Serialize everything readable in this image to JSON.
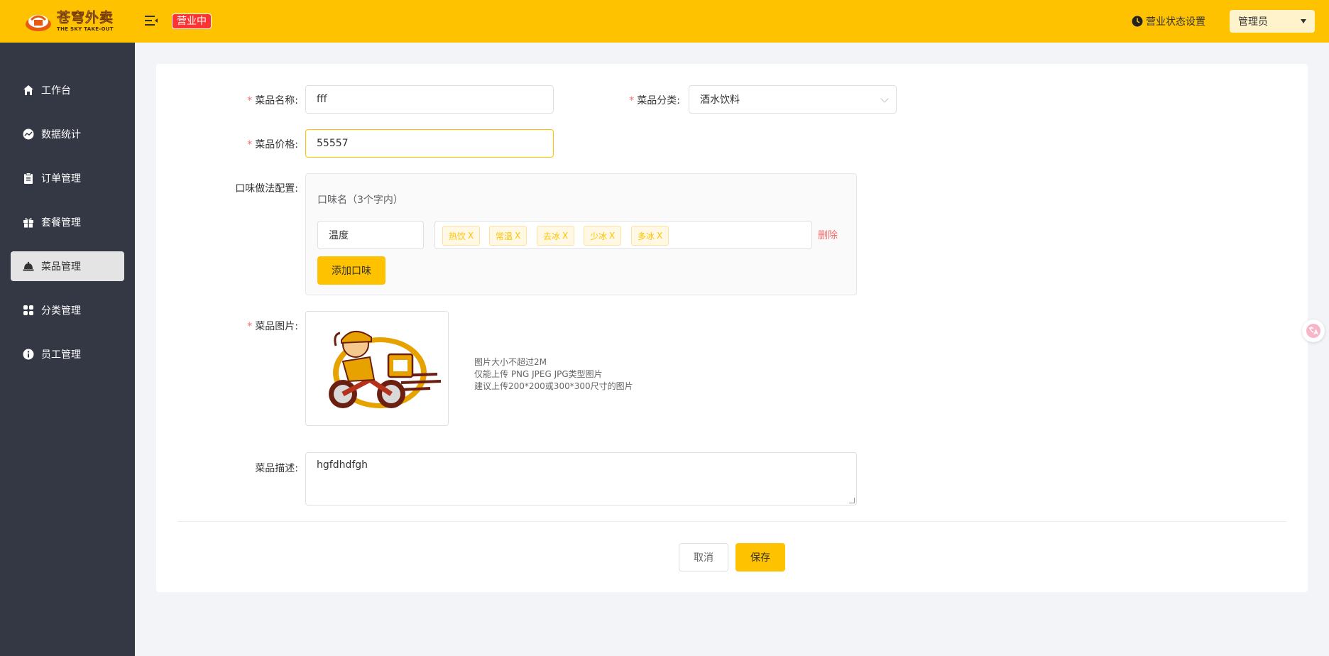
{
  "header": {
    "logo_cn": "苍穹外卖",
    "logo_en": "THE SKY TAKE-OUT",
    "status_badge": "营业中",
    "biz_settings": "营业状态设置",
    "user": "管理员"
  },
  "sidebar": {
    "items": [
      {
        "label": "工作台",
        "icon": "home-icon"
      },
      {
        "label": "数据统计",
        "icon": "chart-icon"
      },
      {
        "label": "订单管理",
        "icon": "clipboard-icon"
      },
      {
        "label": "套餐管理",
        "icon": "gift-icon"
      },
      {
        "label": "菜品管理",
        "icon": "dish-icon",
        "active": true
      },
      {
        "label": "分类管理",
        "icon": "grid-icon"
      },
      {
        "label": "员工管理",
        "icon": "info-icon"
      }
    ]
  },
  "form": {
    "name_label": "菜品名称:",
    "name_value": "fff",
    "category_label": "菜品分类:",
    "category_value": "酒水饮料",
    "price_label": "菜品价格:",
    "price_value": "55557",
    "flavor_label": "口味做法配置:",
    "flavor_hint": "口味名（3个字内）",
    "flavor_name": "温度",
    "flavor_tags": [
      "热饮",
      "常温",
      "去冰",
      "少冰",
      "多冰"
    ],
    "tag_close": "X",
    "flavor_delete": "删除",
    "add_flavor": "添加口味",
    "image_label": "菜品图片:",
    "image_tips": [
      "图片大小不超过2M",
      "仅能上传 PNG JPEG JPG类型图片",
      "建议上传200*200或300*300尺寸的图片"
    ],
    "desc_label": "菜品描述:",
    "desc_value": "hgfdhdfgh",
    "cancel": "取消",
    "save": "保存"
  },
  "colors": {
    "brand": "#ffc200",
    "sidebar_bg": "#343744",
    "danger": "#f56c6c",
    "badge": "#fd3333"
  }
}
